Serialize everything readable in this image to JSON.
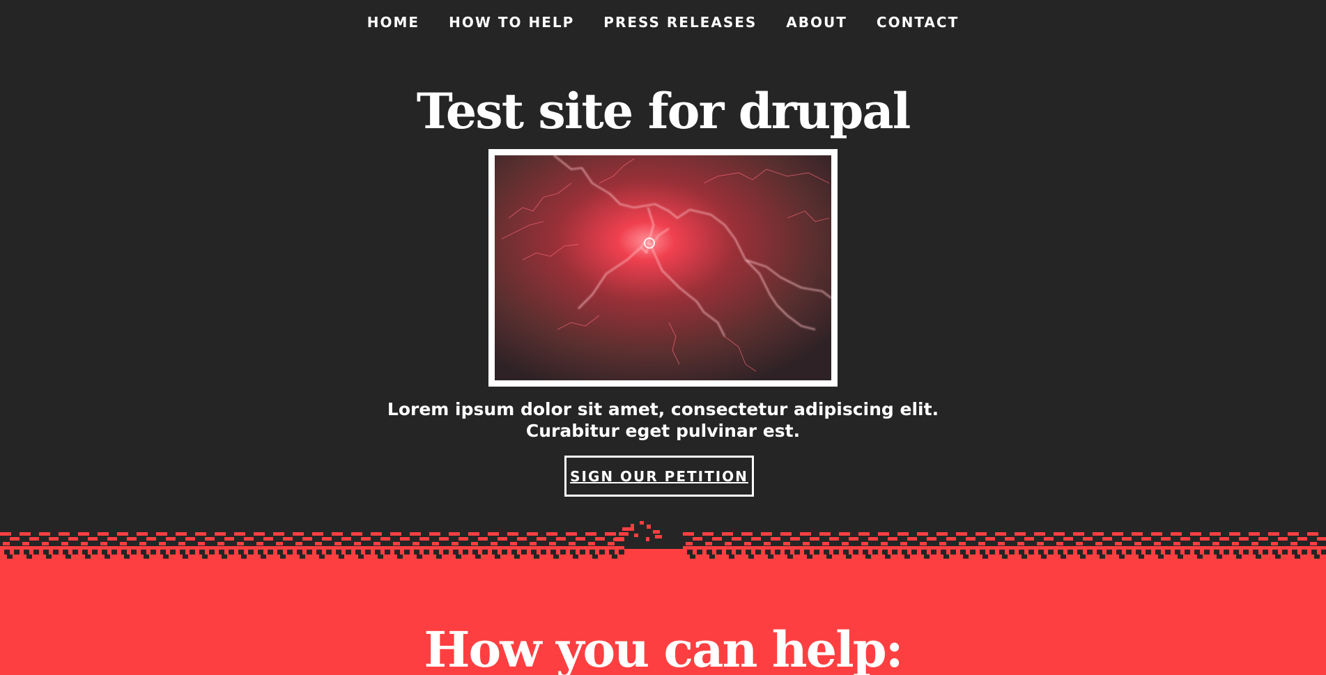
{
  "nav": {
    "items": [
      {
        "label": "HOME"
      },
      {
        "label": "HOW TO HELP"
      },
      {
        "label": "PRESS RELEASES"
      },
      {
        "label": "ABOUT"
      },
      {
        "label": "CONTACT"
      }
    ]
  },
  "hero": {
    "title": "Test site for drupal",
    "image_icon": "lightning-image",
    "lede_line1": "Lorem ipsum dolor sit amet, consectetur adipiscing elit.",
    "lede_line2": "Curabitur eget pulvinar est.",
    "cta_label": "SIGN OUR PETITION"
  },
  "help": {
    "title": "How you can help:"
  },
  "colors": {
    "dark_bg": "#252525",
    "accent_red": "#fe3f41",
    "text": "#ffffff"
  }
}
